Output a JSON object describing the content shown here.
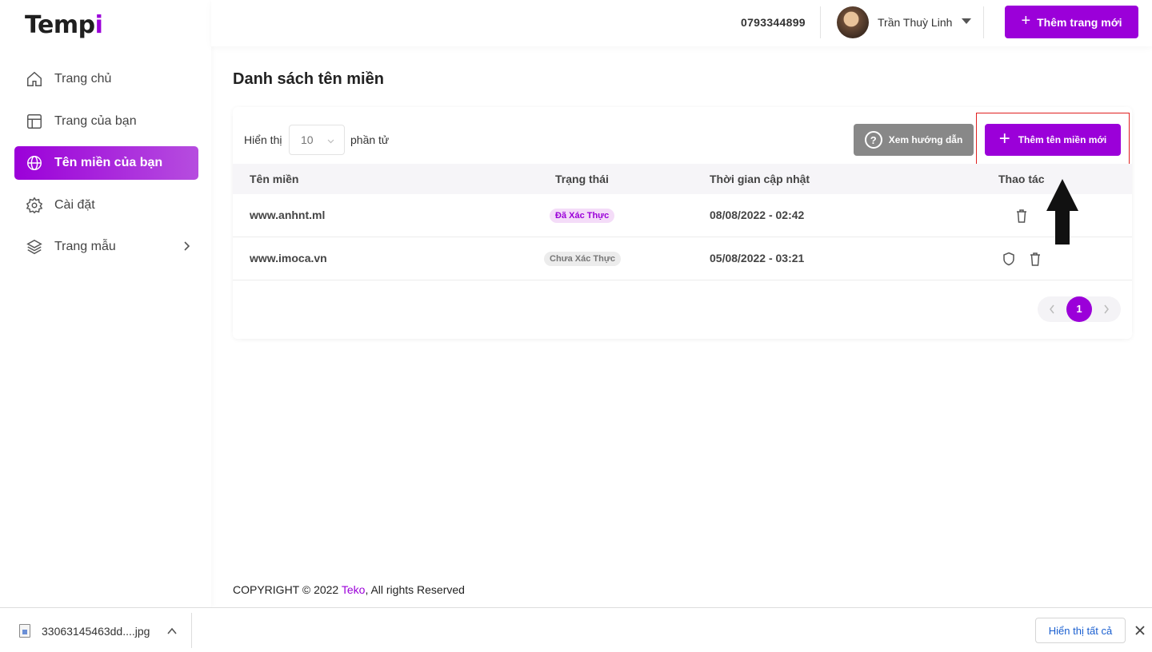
{
  "app": {
    "logo_main": "Temp",
    "logo_accent": "i"
  },
  "sidebar": {
    "items": [
      {
        "label": "Trang chủ",
        "icon": "home-icon"
      },
      {
        "label": "Trang của bạn",
        "icon": "layout-icon"
      },
      {
        "label": "Tên miền của bạn",
        "icon": "globe-icon",
        "active": true
      },
      {
        "label": "Cài đặt",
        "icon": "gear-icon"
      },
      {
        "label": "Trang mẫu",
        "icon": "layers-icon"
      }
    ]
  },
  "header": {
    "phone": "0793344899",
    "user_name": "Trần Thuỳ Linh",
    "new_page_label": "Thêm trang mới"
  },
  "main": {
    "title": "Danh sách tên miền",
    "show_label": "Hiển thị",
    "page_size": "10",
    "items_label": "phần tử",
    "guide_label": "Xem hướng dẫn",
    "add_domain_label": "Thêm tên miền mới",
    "columns": [
      "Tên miền",
      "Trạng thái",
      "Thời gian cập nhật",
      "Thao tác"
    ],
    "rows": [
      {
        "domain": "www.anhnt.ml",
        "status": "Đã Xác Thực",
        "updated": "08/08/2022 - 02:42",
        "actions": [
          "trash-icon"
        ]
      },
      {
        "domain": "www.imoca.vn",
        "status": "Chưa Xác Thực",
        "updated": "05/08/2022 - 03:21",
        "actions": [
          "shield-icon",
          "trash-icon"
        ]
      }
    ],
    "current_page": "1"
  },
  "footer": {
    "prefix": "COPYRIGHT © 2022 ",
    "brand": "Teko",
    "suffix": ", All rights Reserved"
  },
  "download_bar": {
    "file_name": "33063145463dd....jpg",
    "show_all_label": "Hiển thị tất cả"
  },
  "colors": {
    "accent": "#9b00d9",
    "guide_button": "#888888",
    "highlight": "#e02020"
  }
}
